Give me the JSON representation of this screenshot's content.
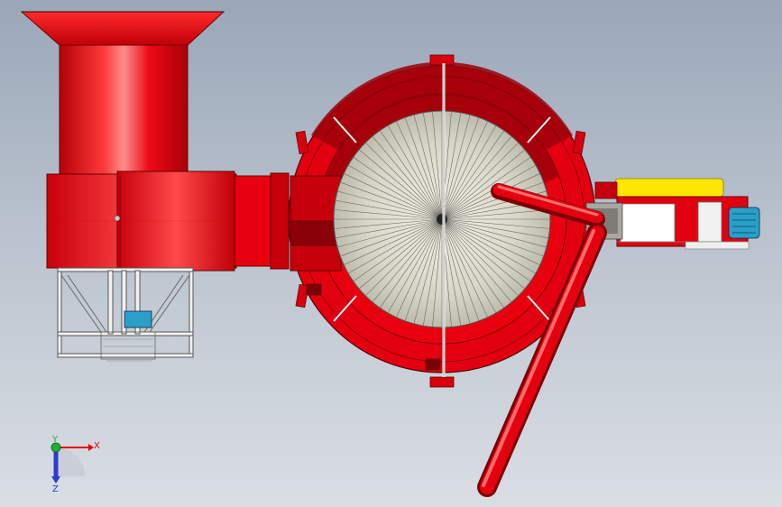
{
  "viewport": {
    "background_top": "#9aa7b8",
    "background_bottom": "#d9dee3"
  },
  "model": {
    "primary_color": "#e4000f",
    "shadow_color": "#8a0008",
    "frame_color": "#f2f2f2",
    "hopper_color": "#ffe600",
    "motor_color": "#2aa0c8"
  },
  "triad": {
    "x_label": "X",
    "y_label": "Y",
    "z_label": "Z",
    "x_color": "#e4000f",
    "y_color": "#1fae3a",
    "z_color": "#2a3bd6"
  }
}
